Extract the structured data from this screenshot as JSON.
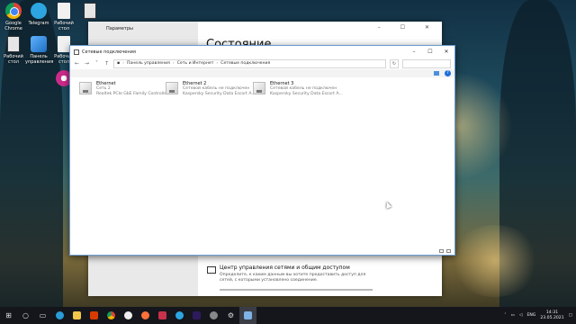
{
  "desktop": {
    "icons": [
      {
        "label": "Google Chrome",
        "icon": "chrome-icon"
      },
      {
        "label": "Telegram",
        "icon": "telegram-icon"
      },
      {
        "label": "Рабочий стол",
        "icon": "file-icon"
      },
      {
        "label": "",
        "icon": "file-icon"
      },
      {
        "label": "Рабочий стол",
        "icon": "file-icon"
      },
      {
        "label": "Панель управления",
        "icon": "control-panel-icon"
      },
      {
        "label": "Рабочий стол",
        "icon": "file-icon"
      }
    ]
  },
  "settings_window": {
    "title": "Параметры",
    "heading": "Состояние",
    "network_center_title": "Центр управления сетями и общим доступом",
    "network_center_desc": "Определите, к каким данным вы хотите предоставить доступ для сетей, с которыми установлено соединение."
  },
  "network_window": {
    "title": "Сетевые подключения",
    "breadcrumbs": [
      "Панель управления",
      "Сеть и Интернет",
      "Сетевые подключения"
    ],
    "adapters": [
      {
        "name": "Ethernet",
        "line1": "Сеть 2",
        "line2": "Realtek PCIe GbE Family Controller"
      },
      {
        "name": "Ethernet 2",
        "line1": "Сетевой кабель не подключен",
        "line2": "Kaspersky Security Data Escort A..."
      },
      {
        "name": "Ethernet 3",
        "line1": "Сетевой кабель не подключен",
        "line2": "Kaspersky Security Data Escort A..."
      }
    ]
  },
  "taskbar": {
    "language": "ENG",
    "time": "14:31",
    "date": "23.05.2021"
  },
  "colors": {
    "accent": "#1e6fd9",
    "taskbar": "#14161c",
    "window_border": "#6b9cd0"
  }
}
